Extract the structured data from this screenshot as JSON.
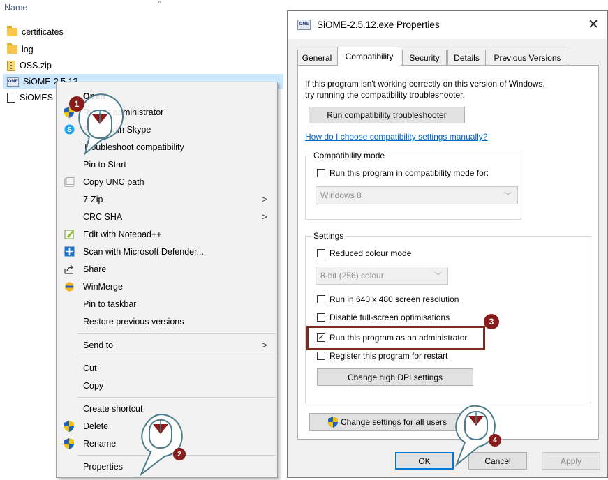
{
  "explorer": {
    "column_header": "Name",
    "sort_indicator": "^",
    "files": [
      {
        "name": "certificates",
        "icon": "folder-icon"
      },
      {
        "name": "log",
        "icon": "folder-icon"
      },
      {
        "name": "OSS.zip",
        "icon": "zip-icon"
      },
      {
        "name": "SiOME-2.5.12",
        "icon": "siome-exe-icon"
      },
      {
        "name": "SiOMES",
        "icon": "document-icon"
      }
    ]
  },
  "context_menu": {
    "items": [
      {
        "label": "Open",
        "bold": true
      },
      {
        "label": "Run as administrator"
      },
      {
        "label": "Share with Skype"
      },
      {
        "label": "Troubleshoot compatibility"
      },
      {
        "label": "Pin to Start"
      },
      {
        "label": "Copy UNC path"
      },
      {
        "label": "7-Zip",
        "submenu": ">"
      },
      {
        "label": "CRC SHA",
        "submenu": ">"
      },
      {
        "label": "Edit with Notepad++"
      },
      {
        "label": "Scan with Microsoft Defender..."
      },
      {
        "label": "Share"
      },
      {
        "label": "WinMerge"
      },
      {
        "label": "Pin to taskbar"
      },
      {
        "label": "Restore previous versions"
      },
      {
        "label": "Send to",
        "submenu": ">"
      },
      {
        "label": "Cut"
      },
      {
        "label": "Copy"
      },
      {
        "label": "Create shortcut"
      },
      {
        "label": "Delete"
      },
      {
        "label": "Rename"
      },
      {
        "label": "Properties"
      }
    ]
  },
  "dialog": {
    "icon_text": "OME",
    "title": "SiOME-2.5.12.exe Properties",
    "close_glyph": "✕",
    "tabs": [
      "General",
      "Compatibility",
      "Security",
      "Details",
      "Previous Versions"
    ],
    "active_tab": "Compatibility",
    "intro_line1": "If this program isn't working correctly on this version of Windows,",
    "intro_line2": "try running the compatibility troubleshooter.",
    "run_troubleshooter": "Run compatibility troubleshooter",
    "help_link": "How do I choose compatibility settings manually?",
    "compat_mode": {
      "label": "Compatibility mode",
      "checkbox": "Run this program in compatibility mode for:",
      "checked": false,
      "selected": "Windows 8"
    },
    "settings": {
      "label": "Settings",
      "reduced_colour": "Reduced colour mode",
      "colour_selected": "8-bit (256) colour",
      "resolution": "Run in 640 x 480 screen resolution",
      "fullscreen": "Disable full-screen optimisations",
      "admin": "Run this program as an administrator",
      "admin_checked": true,
      "admin_check_glyph": "✓",
      "restart": "Register this program for restart",
      "high_dpi": "Change high DPI settings"
    },
    "change_all_users": "Change settings for all users",
    "ok": "OK",
    "cancel": "Cancel",
    "apply": "Apply"
  },
  "callouts": [
    "1",
    "2",
    "3",
    "4"
  ],
  "colors": {
    "selection": "#cce8ff",
    "highlight_border": "#7b2d1e",
    "badge": "#8a1c1c",
    "link": "#0066cc",
    "focus": "#0078d7"
  }
}
